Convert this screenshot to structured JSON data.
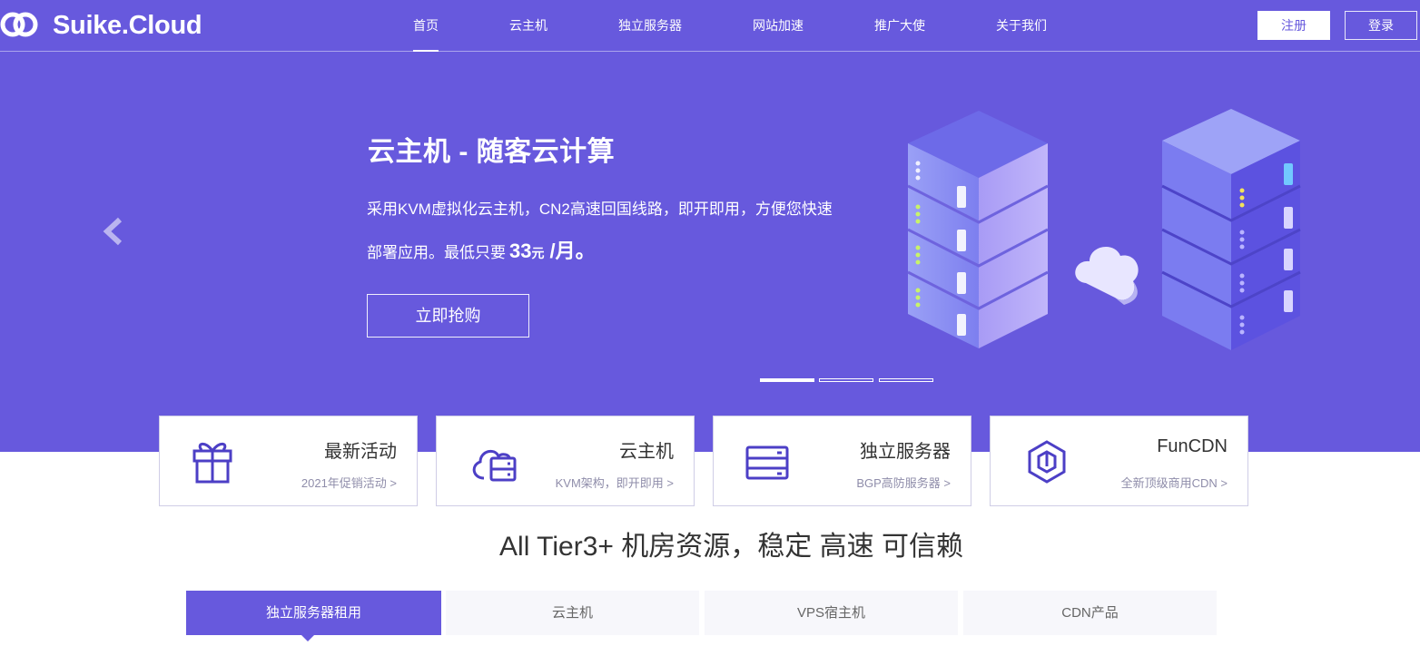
{
  "brand": {
    "name": "Suike.Cloud"
  },
  "nav": {
    "items": [
      {
        "label": "首页",
        "active": true
      },
      {
        "label": "云主机"
      },
      {
        "label": "独立服务器"
      },
      {
        "label": "网站加速"
      },
      {
        "label": "推广大使"
      },
      {
        "label": "关于我们"
      }
    ],
    "register_label": "注册",
    "login_label": "登录"
  },
  "hero": {
    "title": "云主机 - 随客云计算",
    "desc_line1": "采用KVM虚拟化云主机，CN2高速回国线路，即开即用，方便您快速",
    "desc_line2": "部署应用。最低只要",
    "price": "33",
    "price_unit": "元",
    "price_period": "/月。",
    "cta_label": "立即抢购",
    "slides": [
      {
        "active": true
      },
      {
        "active": false
      },
      {
        "active": false
      }
    ]
  },
  "cards": [
    {
      "title": "最新活动",
      "subtitle": "2021年促销活动 >",
      "icon": "gift-icon"
    },
    {
      "title": "云主机",
      "subtitle": "KVM架构，即开即用 >",
      "icon": "cloud-server-icon"
    },
    {
      "title": "独立服务器",
      "subtitle": "BGP高防服务器 >",
      "icon": "server-rack-icon"
    },
    {
      "title": "FunCDN",
      "subtitle": "全新顶级商用CDN >",
      "icon": "cdn-hexagon-icon"
    }
  ],
  "section": {
    "heading": "All Tier3+ 机房资源，稳定 高速 可信赖"
  },
  "tabs": [
    {
      "label": "独立服务器租用",
      "active": true
    },
    {
      "label": "云主机"
    },
    {
      "label": "VPS宿主机"
    },
    {
      "label": "CDN产品"
    }
  ],
  "colors": {
    "primary": "#6759dd",
    "card_border": "#cfcde6",
    "muted_text": "#8f8daa",
    "tab_bg": "#f7f7fb"
  }
}
